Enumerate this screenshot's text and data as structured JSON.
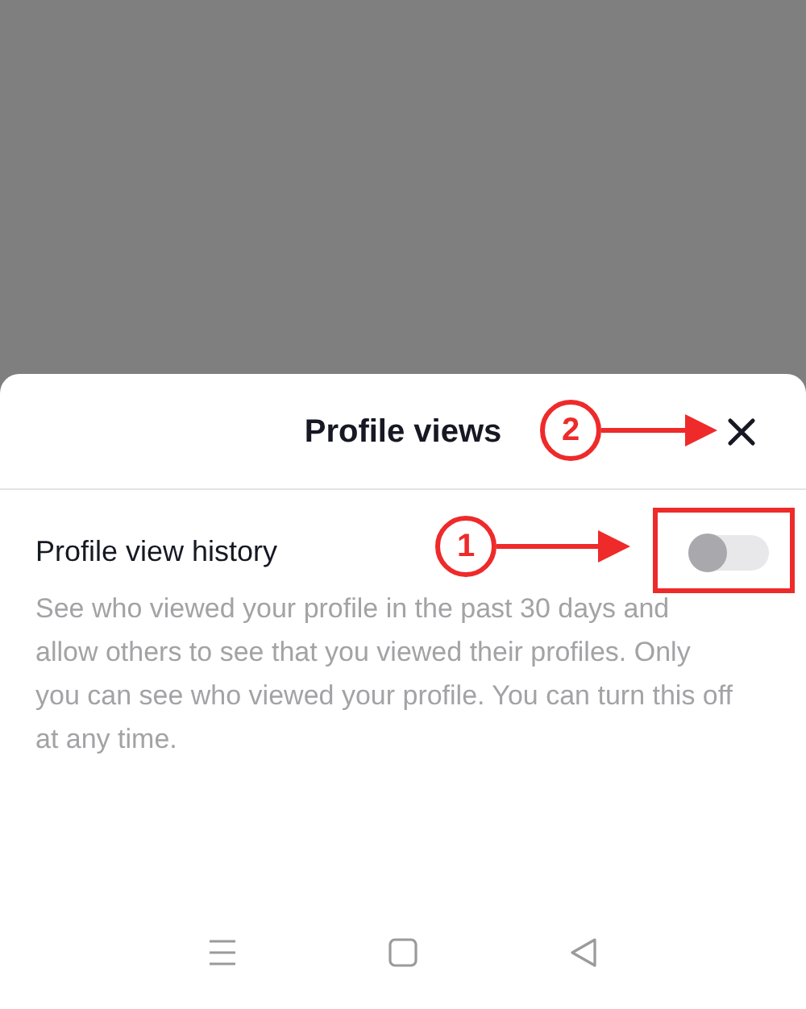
{
  "sheet": {
    "title": "Profile views",
    "annotation": {
      "number": "2"
    }
  },
  "setting": {
    "label": "Profile view history",
    "on": false,
    "annotation": {
      "number": "1"
    },
    "description": "See who viewed your profile in the past 30 days and allow others to see that you viewed their profiles. Only you can see who viewed your profile. You can turn this off at any time."
  }
}
